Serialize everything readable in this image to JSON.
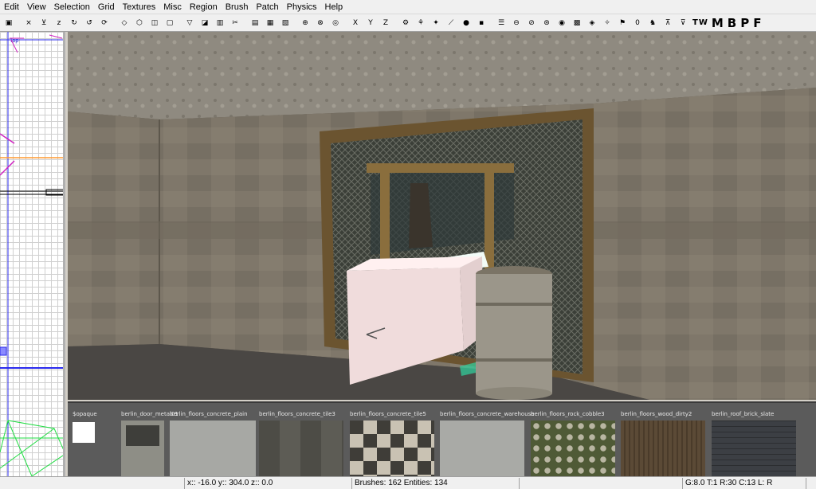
{
  "menu": [
    "Edit",
    "View",
    "Selection",
    "Grid",
    "Textures",
    "Misc",
    "Region",
    "Brush",
    "Patch",
    "Physics",
    "Help"
  ],
  "toolbar": {
    "buttons": [
      {
        "name": "save",
        "glyph": "▣"
      },
      {
        "name": "flip-x",
        "glyph": "×"
      },
      {
        "name": "flip-y",
        "glyph": "⊻"
      },
      {
        "name": "flip-z",
        "glyph": "z"
      },
      {
        "name": "rotate-x",
        "glyph": "↻"
      },
      {
        "name": "rotate-y",
        "glyph": "↺"
      },
      {
        "name": "rotate-z",
        "glyph": "⟳"
      },
      {
        "name": "select-complete-tall",
        "glyph": "◇"
      },
      {
        "name": "select-touching",
        "glyph": "⬡"
      },
      {
        "name": "select-partial-tall",
        "glyph": "◫"
      },
      {
        "name": "select-inside",
        "glyph": "▢"
      },
      {
        "name": "csg-subtract",
        "glyph": "▽"
      },
      {
        "name": "csg-merge",
        "glyph": "◪"
      },
      {
        "name": "csg-hollow",
        "glyph": "▥"
      },
      {
        "name": "clipper",
        "glyph": "✂"
      },
      {
        "name": "make-room",
        "glyph": "▤"
      },
      {
        "name": "drag-edges",
        "glyph": "▦"
      },
      {
        "name": "drag-vertices",
        "glyph": "▧"
      },
      {
        "name": "view-change",
        "glyph": "⊕"
      },
      {
        "name": "texture-lock",
        "glyph": "⊗"
      },
      {
        "name": "scale-lock",
        "glyph": "◎"
      },
      {
        "name": "x-axis",
        "glyph": "X"
      },
      {
        "name": "y-axis",
        "glyph": "Y"
      },
      {
        "name": "z-axis",
        "glyph": "Z"
      },
      {
        "name": "patch-mode",
        "glyph": "⚙"
      },
      {
        "name": "bend-mode",
        "glyph": "⚘"
      },
      {
        "name": "insert",
        "glyph": "✦"
      },
      {
        "name": "cap-patch",
        "glyph": "⟋"
      },
      {
        "name": "welding",
        "glyph": "●"
      },
      {
        "name": "drill-down",
        "glyph": "▪"
      },
      {
        "name": "show-entities",
        "glyph": "☰"
      },
      {
        "name": "filter-a",
        "glyph": "⊖"
      },
      {
        "name": "filter-b",
        "glyph": "⊘"
      },
      {
        "name": "filter-c",
        "glyph": "⊛"
      },
      {
        "name": "filter-d",
        "glyph": "◉"
      },
      {
        "name": "filter-e",
        "glyph": "▩"
      },
      {
        "name": "filter-f",
        "glyph": "◈"
      },
      {
        "name": "filter-g",
        "glyph": "✧"
      },
      {
        "name": "filter-h",
        "glyph": "⚑"
      },
      {
        "name": "filter-i",
        "glyph": "0"
      },
      {
        "name": "filter-j",
        "glyph": "♞"
      },
      {
        "name": "filter-k",
        "glyph": "⊼"
      },
      {
        "name": "filter-l",
        "glyph": "⊽"
      }
    ],
    "trailing_text": [
      "TW",
      "M",
      "B",
      "P",
      "F"
    ]
  },
  "ortho": {
    "label": "Top"
  },
  "textures": [
    {
      "name": "$opaque",
      "color": "#ffffff",
      "kind": "opaque"
    },
    {
      "name": "berlin_door_metal01",
      "color": "#6e6e66",
      "kind": "door"
    },
    {
      "name": "berlin_floors_concrete_plain",
      "color": "#a7a8a4",
      "kind": "concrete"
    },
    {
      "name": "berlin_floors_concrete_tile3",
      "color": "#55544e",
      "kind": "tile3"
    },
    {
      "name": "berlin_floors_concrete_tile5",
      "color": "#8a877f",
      "kind": "checker"
    },
    {
      "name": "berlin_floors_concrete_warehouse",
      "color": "#a9aaa6",
      "kind": "concrete"
    },
    {
      "name": "berlin_floors_rock_cobble3",
      "color": "#6e6d58",
      "kind": "cobble"
    },
    {
      "name": "berlin_floors_wood_dirty2",
      "color": "#5b4a36",
      "kind": "wood"
    },
    {
      "name": "berlin_roof_brick_slate",
      "color": "#3c3f44",
      "kind": "slate"
    }
  ],
  "status": {
    "coords": "x:: -16.0  y:: 304.0  z:: 0.0",
    "counts": "Brushes: 162 Entities: 134",
    "grid": "G:8.0 T:1 R:30 C:13 L: R"
  }
}
